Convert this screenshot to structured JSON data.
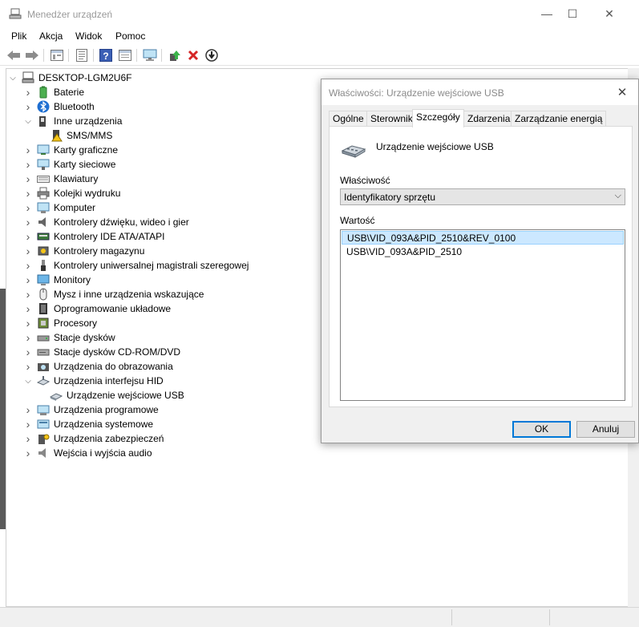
{
  "window": {
    "title": "Menedżer urządzeń",
    "controls": {
      "minimize": "—",
      "maximize": "☐",
      "close": "✕"
    }
  },
  "menu": [
    "Plik",
    "Akcja",
    "Widok",
    "Pomoc"
  ],
  "toolbar": {
    "icons": [
      "back-icon",
      "forward-icon",
      "show-hide-tree-icon",
      "properties-icon",
      "help-icon",
      "view-icon",
      "monitor-scan-icon",
      "update-driver-icon",
      "uninstall-icon",
      "enable-device-icon"
    ]
  },
  "tree": {
    "root": "DESKTOP-LGM2U6F",
    "items": [
      {
        "label": "Baterie",
        "icon": "battery-icon",
        "expander": "collapsed",
        "level": 1
      },
      {
        "label": "Bluetooth",
        "icon": "bluetooth-icon",
        "expander": "collapsed",
        "level": 1
      },
      {
        "label": "Inne urządzenia",
        "icon": "unknown-device-icon",
        "expander": "expanded",
        "level": 1
      },
      {
        "label": "SMS/MMS",
        "icon": "warning-device-icon",
        "expander": "none",
        "level": 2
      },
      {
        "label": "Karty graficzne",
        "icon": "display-adapter-icon",
        "expander": "collapsed",
        "level": 1
      },
      {
        "label": "Karty sieciowe",
        "icon": "network-adapter-icon",
        "expander": "collapsed",
        "level": 1
      },
      {
        "label": "Klawiatury",
        "icon": "keyboard-icon",
        "expander": "collapsed",
        "level": 1
      },
      {
        "label": "Kolejki wydruku",
        "icon": "printer-icon",
        "expander": "collapsed",
        "level": 1
      },
      {
        "label": "Komputer",
        "icon": "computer-icon",
        "expander": "collapsed",
        "level": 1
      },
      {
        "label": "Kontrolery dźwięku, wideo i gier",
        "icon": "speaker-icon",
        "expander": "collapsed",
        "level": 1
      },
      {
        "label": "Kontrolery IDE ATA/ATAPI",
        "icon": "ide-controller-icon",
        "expander": "collapsed",
        "level": 1
      },
      {
        "label": "Kontrolery magazynu",
        "icon": "storage-controller-icon",
        "expander": "collapsed",
        "level": 1
      },
      {
        "label": "Kontrolery uniwersalnej magistrali szeregowej",
        "icon": "usb-icon",
        "expander": "collapsed",
        "level": 1
      },
      {
        "label": "Monitory",
        "icon": "monitor-icon",
        "expander": "collapsed",
        "level": 1
      },
      {
        "label": "Mysz i inne urządzenia wskazujące",
        "icon": "mouse-icon",
        "expander": "collapsed",
        "level": 1
      },
      {
        "label": "Oprogramowanie układowe",
        "icon": "firmware-icon",
        "expander": "collapsed",
        "level": 1
      },
      {
        "label": "Procesory",
        "icon": "processor-icon",
        "expander": "collapsed",
        "level": 1
      },
      {
        "label": "Stacje dysków",
        "icon": "disk-drive-icon",
        "expander": "collapsed",
        "level": 1
      },
      {
        "label": "Stacje dysków CD-ROM/DVD",
        "icon": "cd-drive-icon",
        "expander": "collapsed",
        "level": 1
      },
      {
        "label": "Urządzenia do obrazowania",
        "icon": "camera-icon",
        "expander": "collapsed",
        "level": 1
      },
      {
        "label": "Urządzenia interfejsu HID",
        "icon": "hid-icon",
        "expander": "expanded",
        "level": 1
      },
      {
        "label": "Urządzenie wejściowe USB",
        "icon": "hid-device-icon",
        "expander": "none",
        "level": 2
      },
      {
        "label": "Urządzenia programowe",
        "icon": "software-device-icon",
        "expander": "collapsed",
        "level": 1
      },
      {
        "label": "Urządzenia systemowe",
        "icon": "system-device-icon",
        "expander": "collapsed",
        "level": 1
      },
      {
        "label": "Urządzenia zabezpieczeń",
        "icon": "security-device-icon",
        "expander": "collapsed",
        "level": 1
      },
      {
        "label": "Wejścia i wyjścia audio",
        "icon": "audio-io-icon",
        "expander": "collapsed",
        "level": 1
      }
    ]
  },
  "dialog": {
    "title": "Właściwości: Urządzenie wejściowe USB",
    "tabs": [
      "Ogólne",
      "Sterownik",
      "Szczegóły",
      "Zdarzenia",
      "Zarządzanie energią"
    ],
    "active_tab": "Szczegóły",
    "device_name": "Urządzenie wejściowe USB",
    "property_label": "Właściwość",
    "property_value": "Identyfikatory sprzętu",
    "value_label": "Wartość",
    "values": [
      "USB\\VID_093A&PID_2510&REV_0100",
      "USB\\VID_093A&PID_2510"
    ],
    "ok_label": "OK",
    "cancel_label": "Anuluj"
  },
  "colors": {
    "selection": "#cce8ff",
    "selection_border": "#99d1ff",
    "dialog_bg": "#f0f0f0",
    "accent": "#0078d7"
  }
}
